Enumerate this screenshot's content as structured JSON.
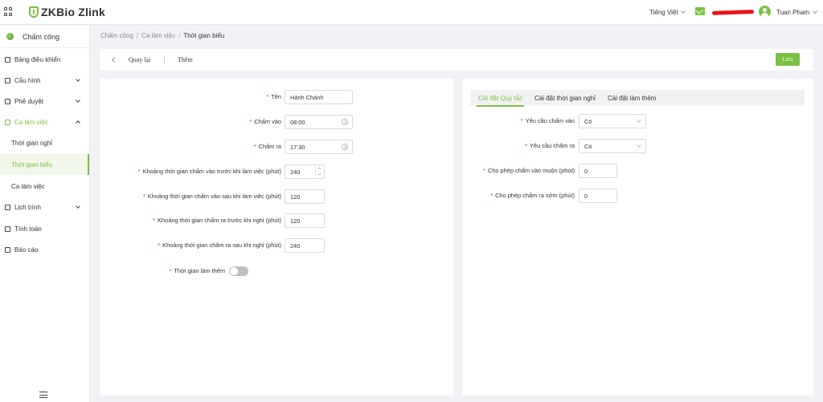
{
  "app": {
    "logo_text": "ZKBio Zlink"
  },
  "header": {
    "language": "Tiếng Việt",
    "username": "Tuan Pham"
  },
  "sidebar": {
    "module": "Chấm công",
    "items": [
      {
        "label": "Bảng điều khiển",
        "icon": "dashboard-icon"
      },
      {
        "label": "Cấu hình",
        "icon": "settings-icon"
      },
      {
        "label": "Phê duyệt",
        "icon": "approval-icon"
      },
      {
        "label": "Ca làm việc",
        "icon": "shift-icon"
      },
      {
        "label": "Lịch trình",
        "icon": "schedule-icon"
      },
      {
        "label": "Tính toán",
        "icon": "calculate-icon"
      },
      {
        "label": "Báo cáo",
        "icon": "report-icon"
      }
    ],
    "subitems": [
      {
        "label": "Thời gian nghỉ"
      },
      {
        "label": "Thời gian biểu"
      },
      {
        "label": "Ca làm việc"
      }
    ]
  },
  "breadcrumb": {
    "items": [
      "Chấm công",
      "Ca làm việc",
      "Thời gian biểu"
    ]
  },
  "actionbar": {
    "back_label": "Quay lại",
    "title": "Thêm",
    "save_label": "Lưu"
  },
  "form_left": {
    "fields": [
      {
        "label": "Tên",
        "value": "Hành Chánh"
      },
      {
        "label": "Chấm vào",
        "value": "08:00"
      },
      {
        "label": "Chấm ra",
        "value": "17:30"
      },
      {
        "label": "Khoảng thời gian chấm vào trước khi làm việc (phút)",
        "value": "240"
      },
      {
        "label": "Khoảng thời gian chấm vào sau khi làm việc (phút)",
        "value": "120"
      },
      {
        "label": "Khoảng thời gian chấm ra trước khi nghỉ (phút)",
        "value": "120"
      },
      {
        "label": "Khoảng thời gian chấm ra sau khi nghỉ (phút)",
        "value": "240"
      },
      {
        "label": "Thời gian làm thêm",
        "value": "off"
      }
    ]
  },
  "form_right": {
    "tabs": [
      "Cài đặt Quy tắc",
      "Cài đặt thời gian nghỉ",
      "Cài đặt làm thêm"
    ],
    "active_tab": 0,
    "fields": [
      {
        "label": "Yêu cầu chấm vào",
        "value": "Có"
      },
      {
        "label": "Yêu cầu chấm ra",
        "value": "Có"
      },
      {
        "label": "Cho phép chấm vào muộn (phút)",
        "value": "0"
      },
      {
        "label": "Cho phép chấm ra sớm (phút)",
        "value": "0"
      }
    ]
  },
  "colors": {
    "accent": "#7ac143",
    "required": "#f5222d",
    "background": "#f0f2f5"
  }
}
